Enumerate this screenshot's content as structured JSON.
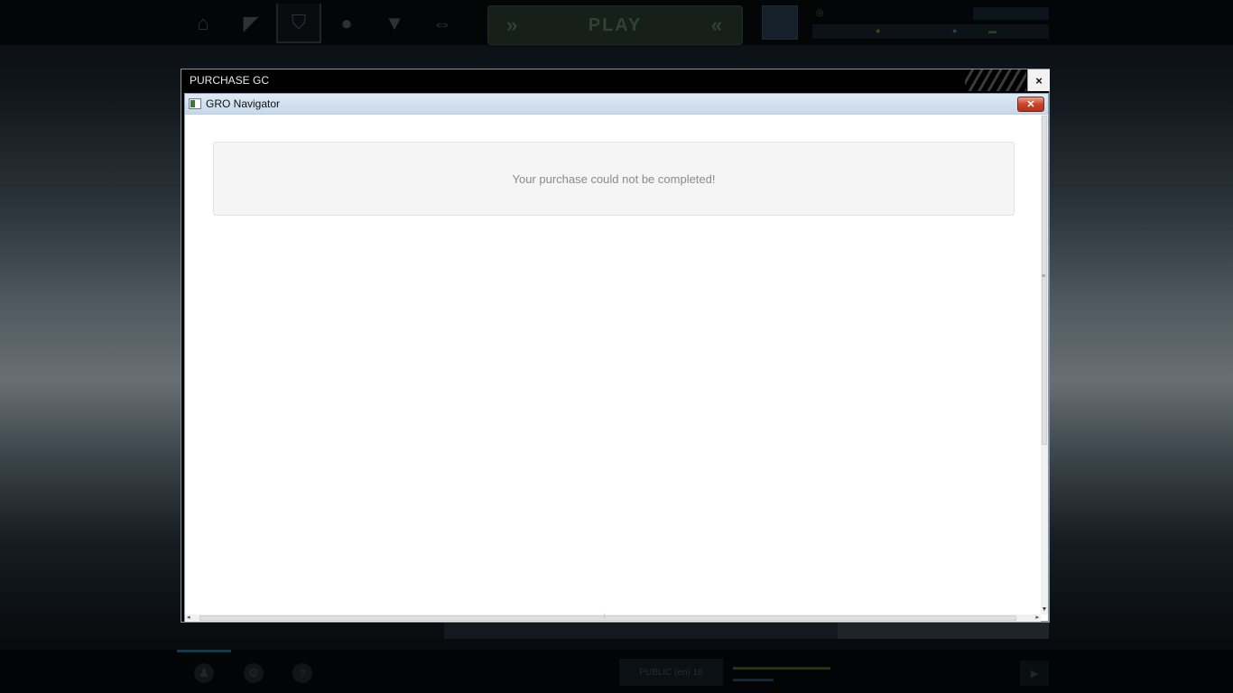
{
  "dialog": {
    "title": "PURCHASE GC",
    "close_label": "×"
  },
  "browser_window": {
    "title": "GRO Navigator",
    "close_label": "✕"
  },
  "message": {
    "text": "Your purchase could not be completed!"
  },
  "background": {
    "play_label": "PLAY",
    "public_label": "PUBLIC (en) 16",
    "nav_icons": [
      "home-icon",
      "weapon-icon",
      "shop-cart-icon",
      "profile-icon",
      "trophy-icon",
      "swap-icon"
    ]
  },
  "colors": {
    "dialog_bg": "#000000",
    "panel_bg": "#f5f5f5",
    "message_text": "#8a8a8a",
    "window_titlebar": "#c7d9eb",
    "close_red": "#c8442a"
  }
}
